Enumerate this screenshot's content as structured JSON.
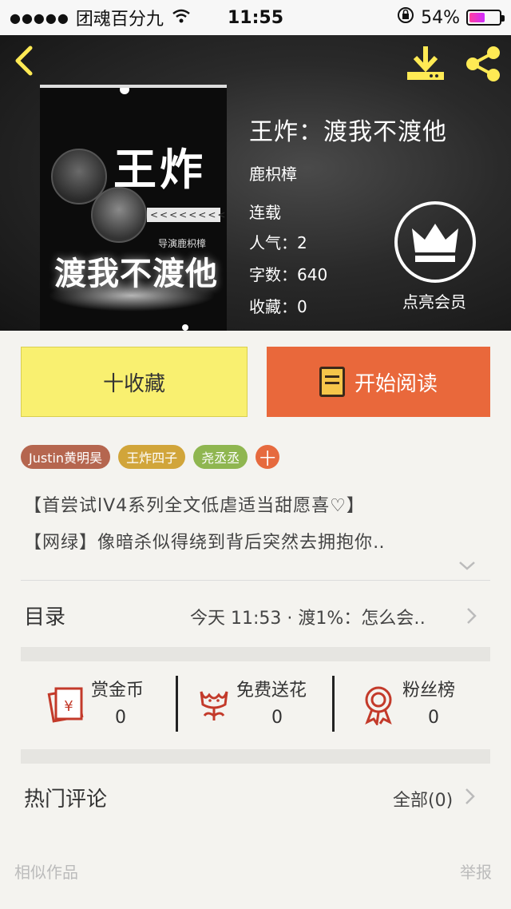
{
  "status_bar": {
    "signal": "●●●●●",
    "carrier": "团魂百分九",
    "time": "11:55",
    "battery": "54%"
  },
  "book": {
    "title": "王炸：渡我不渡他",
    "author": "鹿枳樟",
    "status": "连载",
    "popularity": "人气：2",
    "word_count": "字数：640",
    "favorites": "收藏：0",
    "vip_label": "点亮会员",
    "cover": {
      "title_line1": "王炸",
      "title_line2": "渡我不渡他",
      "director": "导演鹿枳樟",
      "bar_text": "<<<<<<<<<<"
    }
  },
  "actions": {
    "favorite": "十收藏",
    "read": "开始阅读"
  },
  "tags": [
    {
      "label": "Justin黄明昊",
      "color": "#b5664f"
    },
    {
      "label": "王炸四子",
      "color": "#d1a53a"
    },
    {
      "label": "尧丞丞",
      "color": "#8fb650"
    },
    {
      "label": "十",
      "color": "#e66a3e"
    }
  ],
  "description": {
    "line1": "【首尝试lV4系列全文低虐适当甜愿喜♡】",
    "line2": "【网绿】像暗杀似得绕到背后突然去拥抱你‥"
  },
  "toc": {
    "label": "目录",
    "latest": "今天 11:53 · 渡1%：怎么会‥"
  },
  "stats": [
    {
      "label": "赏金币",
      "value": "0",
      "icon": "red-envelope-icon"
    },
    {
      "label": "免费送花",
      "value": "0",
      "icon": "flower-icon"
    },
    {
      "label": "粉丝榜",
      "value": "0",
      "icon": "medal-icon"
    }
  ],
  "comments": {
    "label": "热门评论",
    "all": "全部(0)"
  },
  "footer": {
    "similar": "相似作品",
    "report": "举报"
  },
  "colors": {
    "accent_yellow": "#ffea54",
    "read_button": "#e9683b",
    "fav_button": "#f9f070",
    "icon_red": "#c33a2a"
  }
}
